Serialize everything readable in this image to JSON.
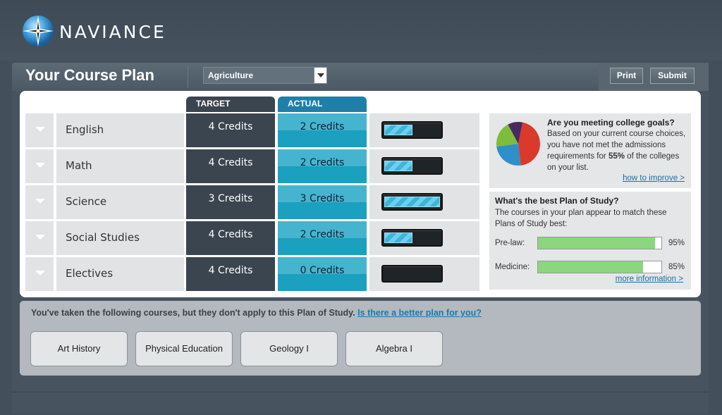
{
  "brand": {
    "name": "NAVIANCE"
  },
  "header": {
    "title": "Your Course Plan",
    "plan_select": {
      "value": "Agriculture"
    },
    "print_label": "Print",
    "submit_label": "Submit"
  },
  "columns": {
    "target": "TARGET",
    "actual": "ACTUAL"
  },
  "rows": [
    {
      "subject": "English",
      "target": "4 Credits",
      "actual": "2 Credits",
      "progress": 0.5
    },
    {
      "subject": "Math",
      "target": "4 Credits",
      "actual": "2 Credits",
      "progress": 0.5
    },
    {
      "subject": "Science",
      "target": "3 Credits",
      "actual": "3 Credits",
      "progress": 1.0
    },
    {
      "subject": "Social Studies",
      "target": "4 Credits",
      "actual": "2 Credits",
      "progress": 0.5
    },
    {
      "subject": "Electives",
      "target": "4 Credits",
      "actual": "0 Credits",
      "progress": 0
    }
  ],
  "goals": {
    "title": "Are you meeting college goals?",
    "text": "Based on your current course choices, you have not met the admissions requirements for",
    "percent": "55%",
    "text_tail": "of the colleges on your list.",
    "link": "how to improve >",
    "pie_colors": [
      "#d93a2b",
      "#2f8fc8",
      "#7dbd3c",
      "#4a2860"
    ]
  },
  "study": {
    "title": "What's the best Plan of Study?",
    "text": "The courses in your plan appear to match these Plans of Study best:",
    "plans": [
      {
        "name": "Pre-law:",
        "value": "95%",
        "fraction": 0.95
      },
      {
        "name": "Medicine:",
        "value": "85%",
        "fraction": 0.85
      }
    ],
    "link": "more information >"
  },
  "other_courses": {
    "message": "You've taken the following courses, but they don't apply to this Plan of Study.",
    "link": "Is there a better plan for you?",
    "courses": [
      "Art History",
      "Physical Education",
      "Geology I",
      "Algebra I"
    ]
  }
}
